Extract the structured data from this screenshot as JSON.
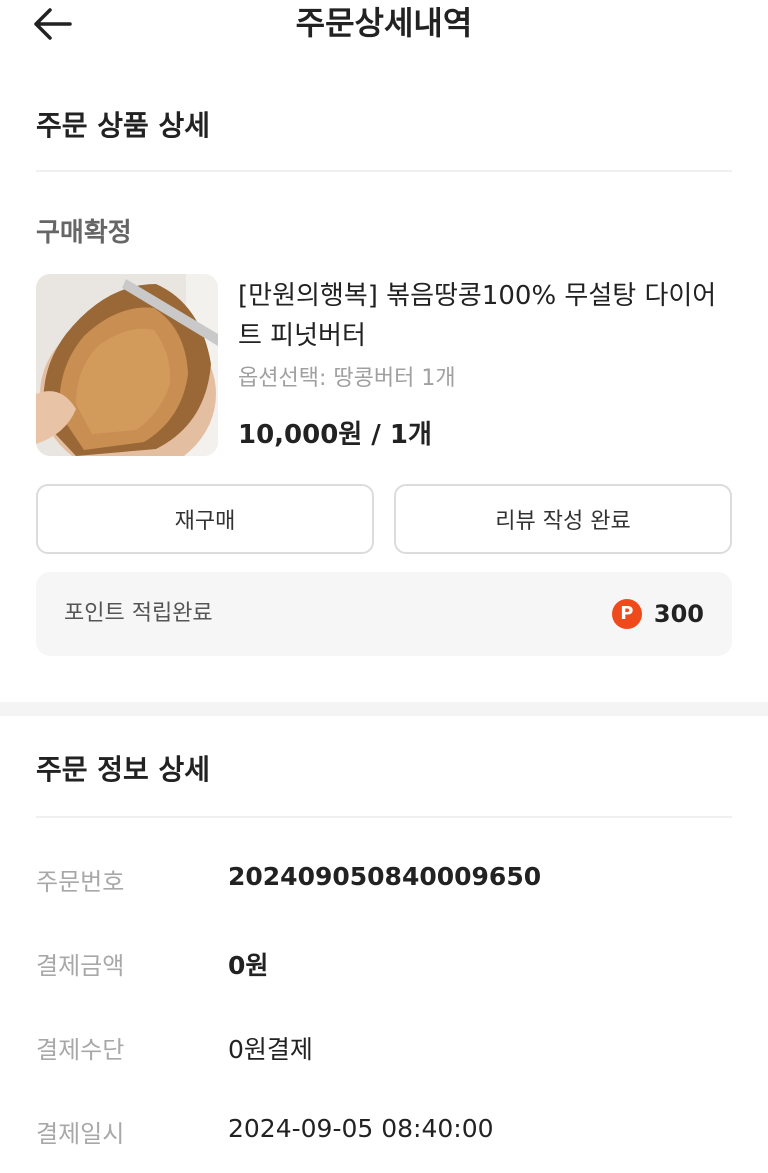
{
  "header": {
    "title": "주문상세내역",
    "back_icon": "arrow-left-icon"
  },
  "product_section": {
    "title": "주문 상품 상세",
    "status": "구매확정",
    "product": {
      "name": "[만원의행복] 볶음땅콩100% 무설탕 다이어트 피넛버터",
      "option": "옵션선택: 땅콩버터 1개",
      "price": "10,000원 / 1개"
    },
    "buttons": {
      "rebuy": "재구매",
      "review": "리뷰 작성 완료"
    },
    "points": {
      "label": "포인트 적립완료",
      "icon_letter": "P",
      "value": "300"
    }
  },
  "order_info": {
    "title": "주문 정보 상세",
    "rows": [
      {
        "label": "주문번호",
        "value": "20240905084000965​0"
      },
      {
        "label": "결제금액",
        "value": "0원"
      },
      {
        "label": "결제수단",
        "value": "0원결제"
      },
      {
        "label": "결제일시",
        "value": "2024-09-05 08:40:00"
      }
    ]
  },
  "colors": {
    "accent": "#ef4a1c",
    "divider": "#f0f0f0",
    "muted": "#a8a8a8"
  }
}
